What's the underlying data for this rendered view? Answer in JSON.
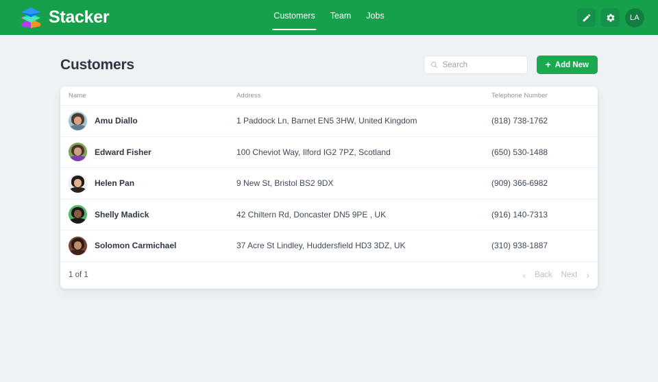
{
  "topbar": {
    "brand_name": "Stacker",
    "logo_colors": {
      "top": "#0b72e7",
      "top_light": "#2f95ff",
      "middle": "#1fd6a0",
      "middle_light": "#45e9bb",
      "bottom_orange": "#f79421",
      "bottom_purple": "#b43df0",
      "accent_pink": "#f2295b"
    },
    "nav": [
      {
        "label": "Customers",
        "active": true
      },
      {
        "label": "Team",
        "active": false
      },
      {
        "label": "Jobs",
        "active": false
      }
    ],
    "actions": [
      {
        "name": "edit-button",
        "icon": "pencil-icon"
      },
      {
        "name": "settings-button",
        "icon": "gear-icon"
      }
    ],
    "user_initials": "LA",
    "bar_color": "#16a04b"
  },
  "page": {
    "title": "Customers",
    "search": {
      "placeholder": "Search",
      "value": "",
      "icon": "search-icon"
    },
    "add_button": {
      "label": "Add New",
      "icon": "plus-icon",
      "color": "#1aa94f"
    }
  },
  "table": {
    "columns": [
      "Name",
      "Address",
      "Telephone Number"
    ],
    "rows": [
      {
        "name": "Amu Diallo",
        "address": "1 Paddock Ln, Barnet EN5 3HW, United Kingdom",
        "telephone": "(818) 738-1762",
        "avatar": {
          "bg": "#9ec6d6",
          "hair": "#503a2c",
          "face": "#d9a483",
          "body": "#5e7f92"
        }
      },
      {
        "name": "Edward Fisher",
        "address": "100 Cheviot Way, Ilford IG2 7PZ, Scotland",
        "telephone": "(650) 530-1488",
        "avatar": {
          "bg": "#7fa35a",
          "hair": "#4a3526",
          "face": "#caa184",
          "body": "#7b3fb0"
        }
      },
      {
        "name": "Helen Pan",
        "address": "9 New St, Bristol BS2 9DX",
        "telephone": "(909) 366-6982",
        "avatar": {
          "bg": "#efefef",
          "hair": "#211a18",
          "face": "#e0b294",
          "body": "#2b2320"
        }
      },
      {
        "name": "Shelly Madick",
        "address": "42 Chiltern Rd, Doncaster DN5 9PE , UK",
        "telephone": "(916) 140-7313",
        "avatar": {
          "bg": "#55b56b",
          "hair": "#191616",
          "face": "#8a5b3c",
          "body": "#1b1717"
        }
      },
      {
        "name": "Solomon Carmichael",
        "address": "37 Acre St Lindley, Huddersfield HD3 3DZ, UK",
        "telephone": "(310) 938-1887",
        "avatar": {
          "bg": "#7a4632",
          "hair": "#2c1c15",
          "face": "#c08e6a",
          "body": "#43221a"
        }
      }
    ],
    "footer": {
      "count_label": "1 of 1",
      "prev_arrow": "‹",
      "back_label": "Back",
      "next_label": "Next",
      "next_arrow": "›"
    }
  }
}
